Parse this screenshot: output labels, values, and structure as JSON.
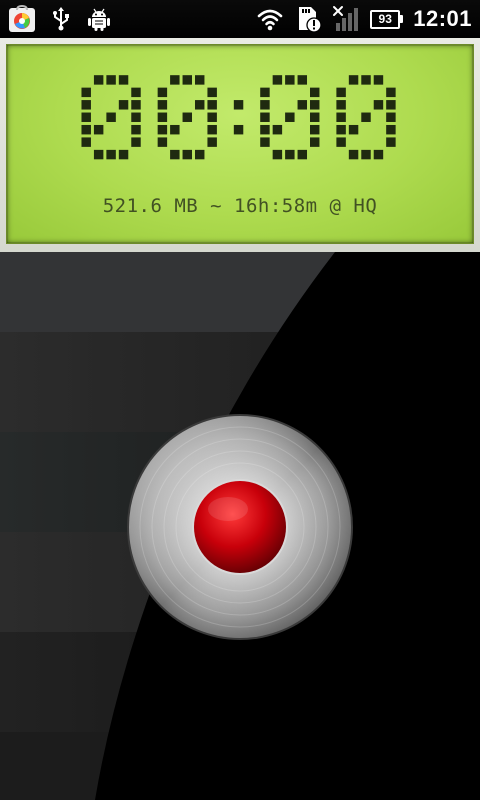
{
  "status_bar": {
    "left_icons": [
      "market-notification-icon",
      "usb-icon",
      "android-debug-icon"
    ],
    "right_icons": [
      "wifi-icon",
      "sd-card-alert-icon",
      "signal-off-icon"
    ],
    "battery_level": "93",
    "time": "12:01"
  },
  "lcd": {
    "timer": "00:00",
    "info": "521.6 MB ~ 16h:58m @ HQ"
  },
  "recorder": {
    "record_button_icon": "record-icon"
  },
  "colors": {
    "lcd_bg": "#aedb4f",
    "lcd_text": "#1f2a10",
    "record_red": "#c8000a"
  }
}
